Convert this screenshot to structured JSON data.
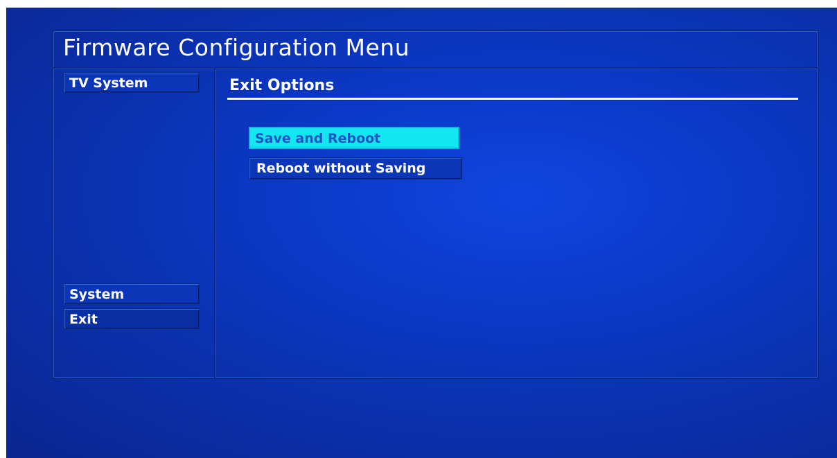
{
  "header": {
    "title": "Firmware Configuration Menu"
  },
  "sidebar": {
    "items": [
      {
        "label": "TV System",
        "selected": false
      },
      {
        "label": "System",
        "selected": false
      },
      {
        "label": "Exit",
        "selected": true
      }
    ]
  },
  "main": {
    "section_title": "Exit Options",
    "options": [
      {
        "label": "Save and Reboot",
        "highlighted": true
      },
      {
        "label": "Reboot without Saving",
        "highlighted": false
      }
    ]
  },
  "colors": {
    "background": "#0b38c4",
    "highlight": "#12e6f0",
    "highlight_text": "#1a57c4",
    "text": "#ffffff"
  }
}
